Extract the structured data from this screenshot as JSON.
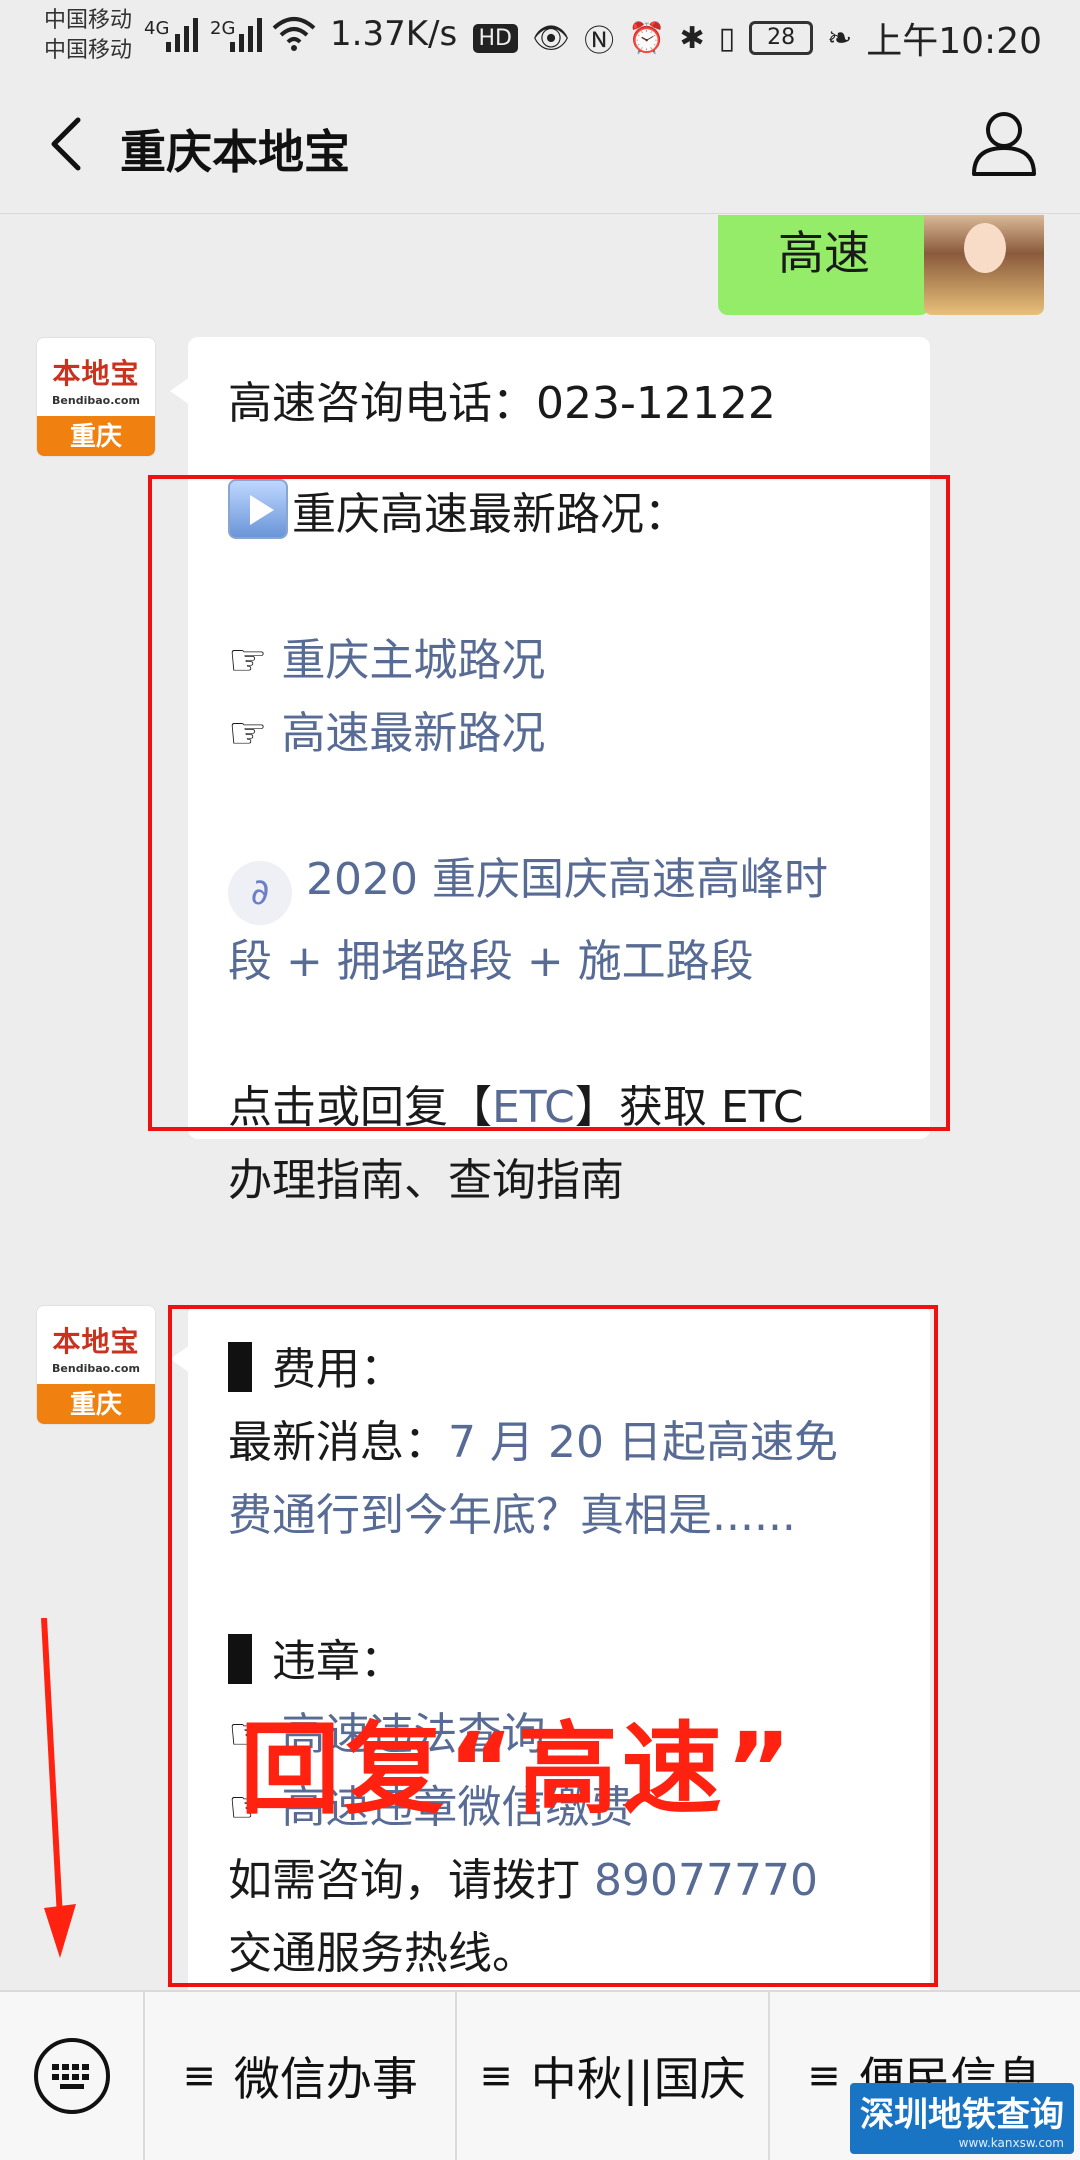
{
  "status_bar": {
    "carrier_1": "中国移动",
    "carrier_2": "中国移动",
    "net_1": "4G",
    "net_2": "2G",
    "speed": "1.37K/s",
    "hd": "HD",
    "battery": "28",
    "time": "上午10:20"
  },
  "header": {
    "title": "重庆本地宝",
    "back_icon": "chevron-left-icon",
    "profile_icon": "user-icon"
  },
  "messages": {
    "sent_text": "高速",
    "logo_cn": "本地宝",
    "logo_en": "Bendibao.com",
    "logo_city": "重庆",
    "msg1": {
      "line1": "高速咨询电话：023-12122",
      "line2": "重庆高速最新路况：",
      "link1_prefix": "☞ ",
      "link1": "重庆主城路况",
      "link2_prefix": "☞ ",
      "link2": "高速最新路况",
      "mini_link_a": "2020 重庆国庆高速高峰时",
      "mini_link_b": "段 + 拥堵路段 + 施工路段",
      "etc_a_pre": "点击或回复【",
      "etc_a_link": "ETC",
      "etc_a_post": "】获取 ETC",
      "etc_b": "办理指南、查询指南"
    },
    "msg2": {
      "fee_head": "费用：",
      "news_pre": "最新消息：",
      "news_link_a": "7 月 20 日起高速免",
      "news_link_b": "费通行到今年底？真相是......",
      "violation_head": "违章：",
      "link3_prefix": "☞ ",
      "link3": "高速违法查询",
      "link4_prefix": "☞ ",
      "link4": "高速违章微信缴费",
      "consult_pre": "如需咨询，请拨打 ",
      "consult_phone": "89077770",
      "consult_b": "交通服务热线。"
    }
  },
  "annotation": {
    "text": "回复“高速”",
    "color": "#ff2211"
  },
  "menu": {
    "keyboard_icon": "keyboard-icon",
    "item1": "微信办事",
    "item2": "中秋||国庆",
    "item3": "便民信息",
    "ham": "≡"
  },
  "watermark": {
    "text": "深圳地铁查询",
    "site": "www.kanxsw.com"
  },
  "colors": {
    "link": "#576b95",
    "sent_bubble": "#95ec69",
    "highlight_box": "#ee1111"
  }
}
